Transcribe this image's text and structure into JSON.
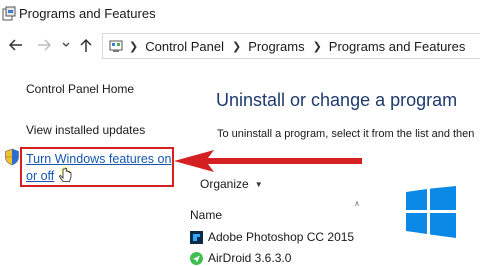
{
  "window": {
    "title": "Programs and Features"
  },
  "breadcrumb": [
    "Control Panel",
    "Programs",
    "Programs and Features"
  ],
  "sidebar": {
    "home": "Control Panel Home",
    "updates": "View installed updates",
    "features": "Turn Windows features on or off"
  },
  "main": {
    "title": "Uninstall or change a program",
    "description": "To uninstall a program, select it from the list and then",
    "organize": "Organize",
    "column_name": "Name",
    "programs": [
      {
        "name": "Adobe Photoshop CC 2015",
        "icon": "photoshop-icon"
      },
      {
        "name": "AirDroid 3.6.3.0",
        "icon": "airdroid-icon"
      }
    ]
  },
  "colors": {
    "link": "#1658b0",
    "highlight": "#d42020",
    "title": "#1e3a6e",
    "windows_logo": "#0a8ae6"
  }
}
